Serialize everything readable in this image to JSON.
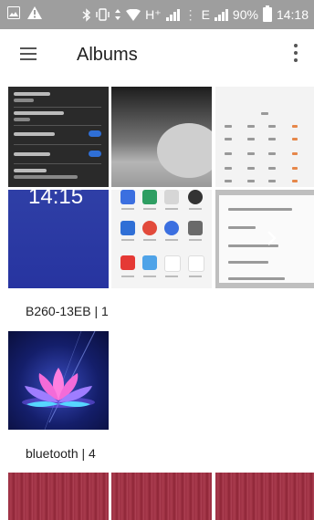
{
  "status": {
    "network": "H⁺",
    "network2": "E",
    "battery": "90%",
    "time": "14:18"
  },
  "appbar": {
    "title": "Albums"
  },
  "albums": [
    {
      "label": "B260-13EB | 1"
    },
    {
      "label": "bluetooth | 4"
    }
  ],
  "thumbs": {
    "lock_time": "14:15"
  },
  "colors": {
    "statusbar": "#9e9e9e",
    "accent": "#2f6fd6"
  }
}
